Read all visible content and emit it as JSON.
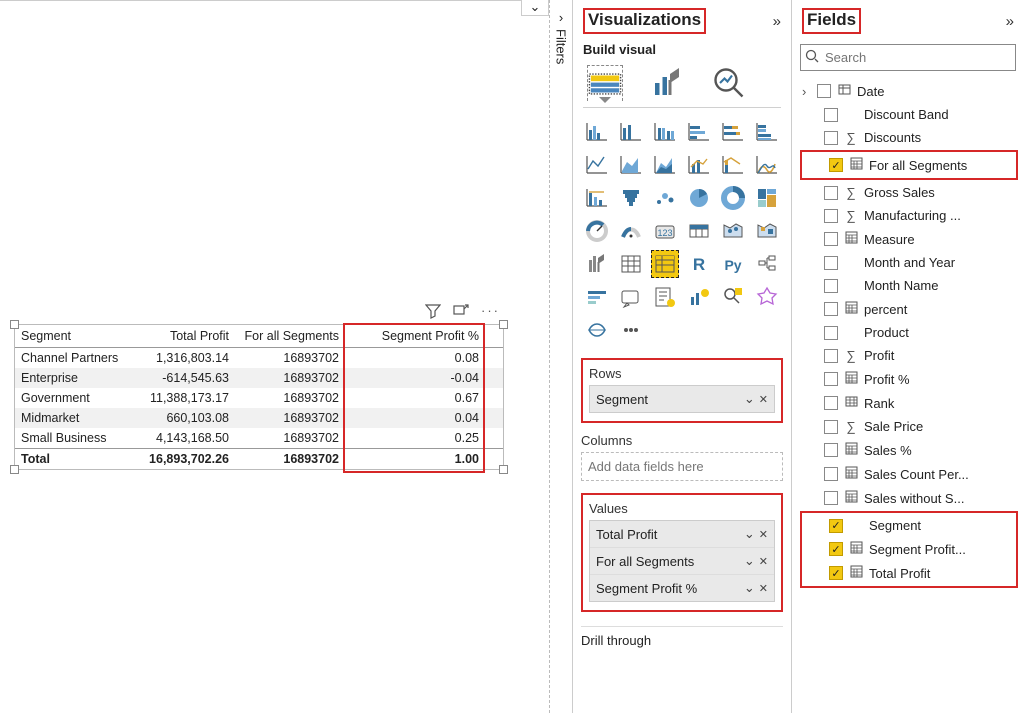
{
  "canvas": {
    "chevron_glyph": "⌄"
  },
  "filters": {
    "label": "Filters",
    "arrow": "›"
  },
  "viz": {
    "title": "Visualizations",
    "build_label": "Build visual",
    "rows": {
      "label": "Rows",
      "items": [
        "Segment"
      ]
    },
    "columns": {
      "label": "Columns",
      "placeholder": "Add data fields here"
    },
    "values": {
      "label": "Values",
      "items": [
        "Total Profit",
        "For all Segments",
        "Segment Profit %"
      ]
    },
    "drill": {
      "label": "Drill through"
    }
  },
  "fields": {
    "title": "Fields",
    "search_placeholder": "Search",
    "items": [
      {
        "name": "Date",
        "checked": false,
        "icon": "table",
        "level": 0,
        "expand": true
      },
      {
        "name": "Discount Band",
        "checked": false,
        "icon": "",
        "level": 1
      },
      {
        "name": "Discounts",
        "checked": false,
        "icon": "sigma",
        "level": 1
      },
      {
        "name": "For all Segments",
        "checked": true,
        "icon": "calc",
        "level": 1,
        "highlight": "single"
      },
      {
        "name": "Gross Sales",
        "checked": false,
        "icon": "sigma",
        "level": 1
      },
      {
        "name": "Manufacturing ...",
        "checked": false,
        "icon": "sigma",
        "level": 1
      },
      {
        "name": "Measure",
        "checked": false,
        "icon": "calc",
        "level": 1
      },
      {
        "name": "Month and Year",
        "checked": false,
        "icon": "",
        "level": 1
      },
      {
        "name": "Month Name",
        "checked": false,
        "icon": "",
        "level": 1
      },
      {
        "name": "percent",
        "checked": false,
        "icon": "calc",
        "level": 1
      },
      {
        "name": "Product",
        "checked": false,
        "icon": "",
        "level": 1
      },
      {
        "name": "Profit",
        "checked": false,
        "icon": "sigma",
        "level": 1
      },
      {
        "name": "Profit %",
        "checked": false,
        "icon": "calc",
        "level": 1
      },
      {
        "name": "Rank",
        "checked": false,
        "icon": "rank",
        "level": 1
      },
      {
        "name": "Sale Price",
        "checked": false,
        "icon": "sigma",
        "level": 1
      },
      {
        "name": "Sales %",
        "checked": false,
        "icon": "calc",
        "level": 1
      },
      {
        "name": "Sales Count Per...",
        "checked": false,
        "icon": "calc",
        "level": 1
      },
      {
        "name": "Sales without S...",
        "checked": false,
        "icon": "calc",
        "level": 1
      },
      {
        "name": "Segment",
        "checked": true,
        "icon": "",
        "level": 1,
        "highlight": "group-start"
      },
      {
        "name": "Segment Profit...",
        "checked": true,
        "icon": "calc",
        "level": 1,
        "highlight": "group"
      },
      {
        "name": "Total Profit",
        "checked": true,
        "icon": "calc",
        "level": 1,
        "highlight": "group-end"
      }
    ]
  },
  "matrix": {
    "columns": [
      "Segment",
      "Total Profit",
      "For all Segments",
      "Segment Profit %"
    ],
    "rows": [
      {
        "seg": "Channel Partners",
        "tp": "1,316,803.14",
        "all": "16893702",
        "pct": "0.08"
      },
      {
        "seg": "Enterprise",
        "tp": "-614,545.63",
        "all": "16893702",
        "pct": "-0.04"
      },
      {
        "seg": "Government",
        "tp": "11,388,173.17",
        "all": "16893702",
        "pct": "0.67"
      },
      {
        "seg": "Midmarket",
        "tp": "660,103.08",
        "all": "16893702",
        "pct": "0.04"
      },
      {
        "seg": "Small Business",
        "tp": "4,143,168.50",
        "all": "16893702",
        "pct": "0.25"
      }
    ],
    "total": {
      "seg": "Total",
      "tp": "16,893,702.26",
      "all": "16893702",
      "pct": "1.00"
    },
    "highlight_col": 3
  }
}
